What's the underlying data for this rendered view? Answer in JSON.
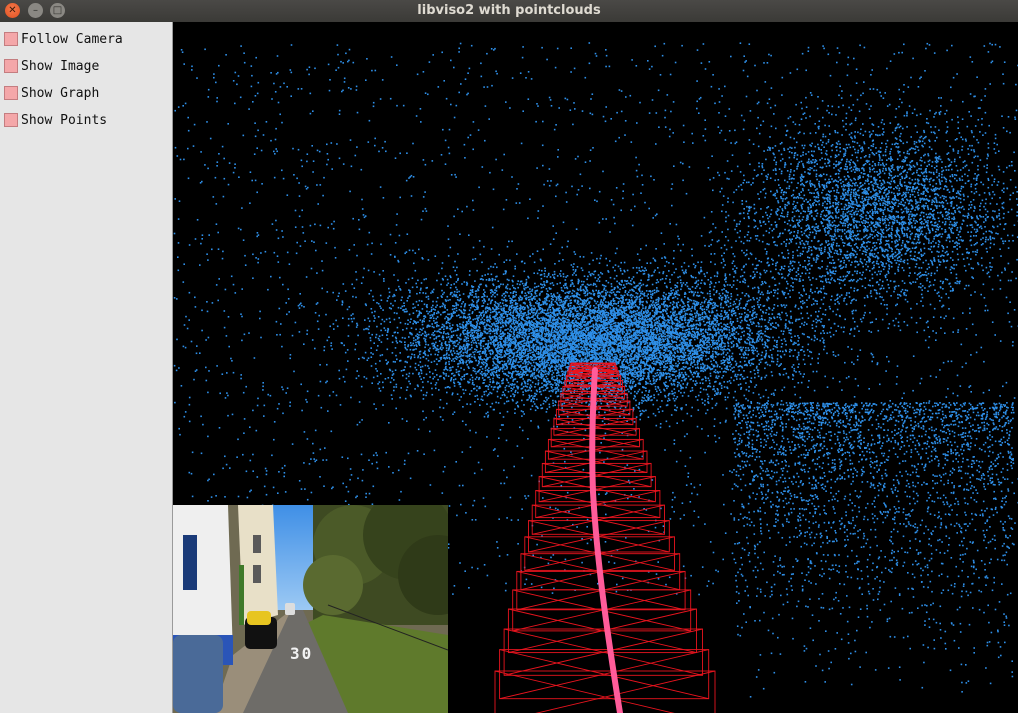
{
  "window": {
    "title": "libviso2 with pointclouds",
    "buttons": [
      "close",
      "minimize",
      "maximize"
    ]
  },
  "panel": {
    "checkboxes": [
      {
        "label": "Follow Camera",
        "checked": false
      },
      {
        "label": "Show Image",
        "checked": false
      },
      {
        "label": "Show Graph",
        "checked": false
      },
      {
        "label": "Show Points",
        "checked": false
      }
    ]
  },
  "viewport": {
    "background": "#000000",
    "point_color": "#2e8fe8",
    "trajectory_color": "#ff5c9a",
    "camera_frustum_color": "#e8141e",
    "camera_image": {
      "sign_text": "30"
    }
  },
  "colors": {
    "titlebar": "#3c3b37",
    "panel_bg": "#e6e6e6",
    "checkbox_fill": "#f4a7a9"
  }
}
